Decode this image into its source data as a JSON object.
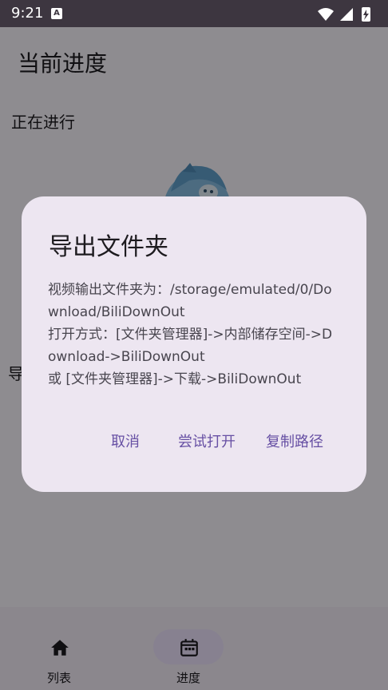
{
  "status_bar": {
    "time": "9:21",
    "notification_icon": "a-icon",
    "wifi_icon": "wifi-icon",
    "signal_icon": "cell-signal-icon",
    "battery_icon": "battery-charging-icon"
  },
  "app": {
    "title": "当前进度",
    "section_running": "正在进行",
    "partial_left_text": "导"
  },
  "bottom_nav": {
    "items": [
      {
        "label": "列表",
        "icon": "home-icon",
        "selected": false
      },
      {
        "label": "进度",
        "icon": "calendar-icon",
        "selected": true
      }
    ]
  },
  "dialog": {
    "title": "导出文件夹",
    "lines": [
      "视频输出文件夹为：/storage/emulated/0/Download/BiliDownOut",
      "打开方式：[文件夹管理器]->内部储存空间->Download->BiliDownOut",
      "或 [文件夹管理器]->下载->BiliDownOut"
    ],
    "buttons": {
      "cancel": "取消",
      "try_open": "尝试打开",
      "copy_path": "复制路径"
    }
  },
  "colors": {
    "accent": "#6750a4",
    "dialog_bg": "#ede6f1",
    "status_bar": "#3d3640"
  }
}
